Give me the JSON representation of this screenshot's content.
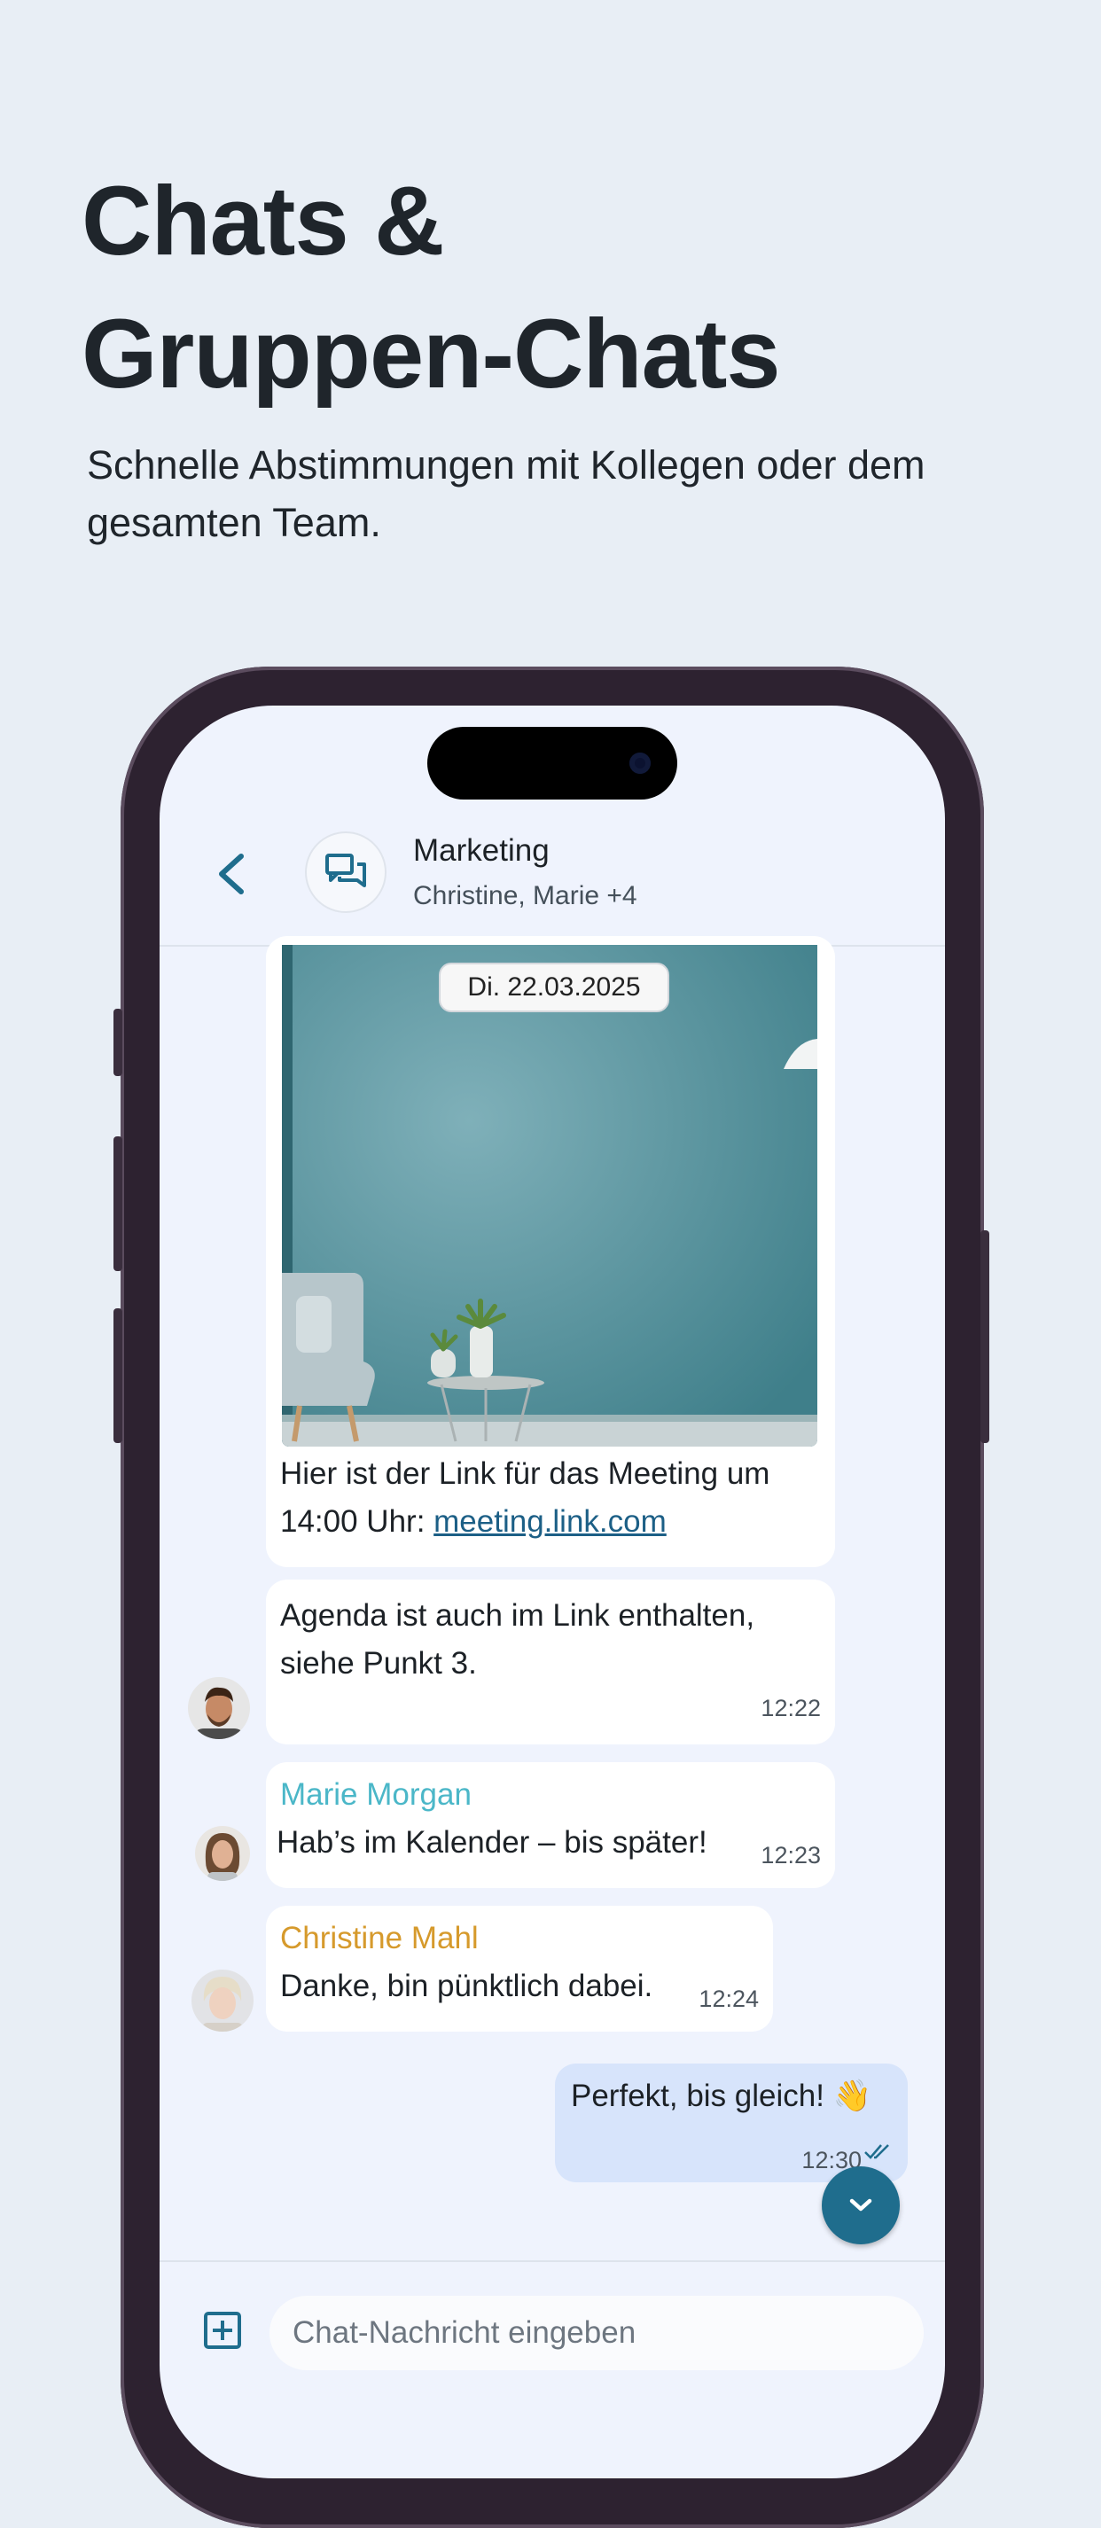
{
  "page": {
    "headline_line1": "Chats &",
    "headline_line2": "Gruppen-Chats",
    "subline": "Schnelle Abstimmungen mit Kollegen oder dem gesamten Team."
  },
  "chat": {
    "title": "Marketing",
    "members": "Christine, Marie +4",
    "date_chip": "Di. 22.03.2025",
    "messages": [
      {
        "text_part1": "Hier ist der Link für das Meeting um 14:00 Uhr: ",
        "link": "meeting.link.com"
      },
      {
        "text": "Agenda ist auch im Link enthalten, siehe Punkt 3.",
        "time": "12:22"
      },
      {
        "sender": "Marie Morgan",
        "text": "Hab’s im Kalender – bis später!",
        "time": "12:23"
      },
      {
        "sender": "Christine Mahl",
        "text": "Danke, bin pünktlich dabei.",
        "time": "12:24"
      },
      {
        "text": "Perfekt, bis gleich! 👋",
        "time": "12:30",
        "status": "read"
      }
    ],
    "composer_placeholder": "Chat-Nachricht eingeben"
  },
  "colors": {
    "accent": "#1f6d8d",
    "sender_marie": "#4bb7c8",
    "sender_christine": "#d69a2c",
    "own_bubble": "#d7e4fb"
  },
  "icons": [
    "back-icon",
    "group-chat-icon",
    "chevron-down-icon",
    "add-icon",
    "double-check-icon"
  ]
}
